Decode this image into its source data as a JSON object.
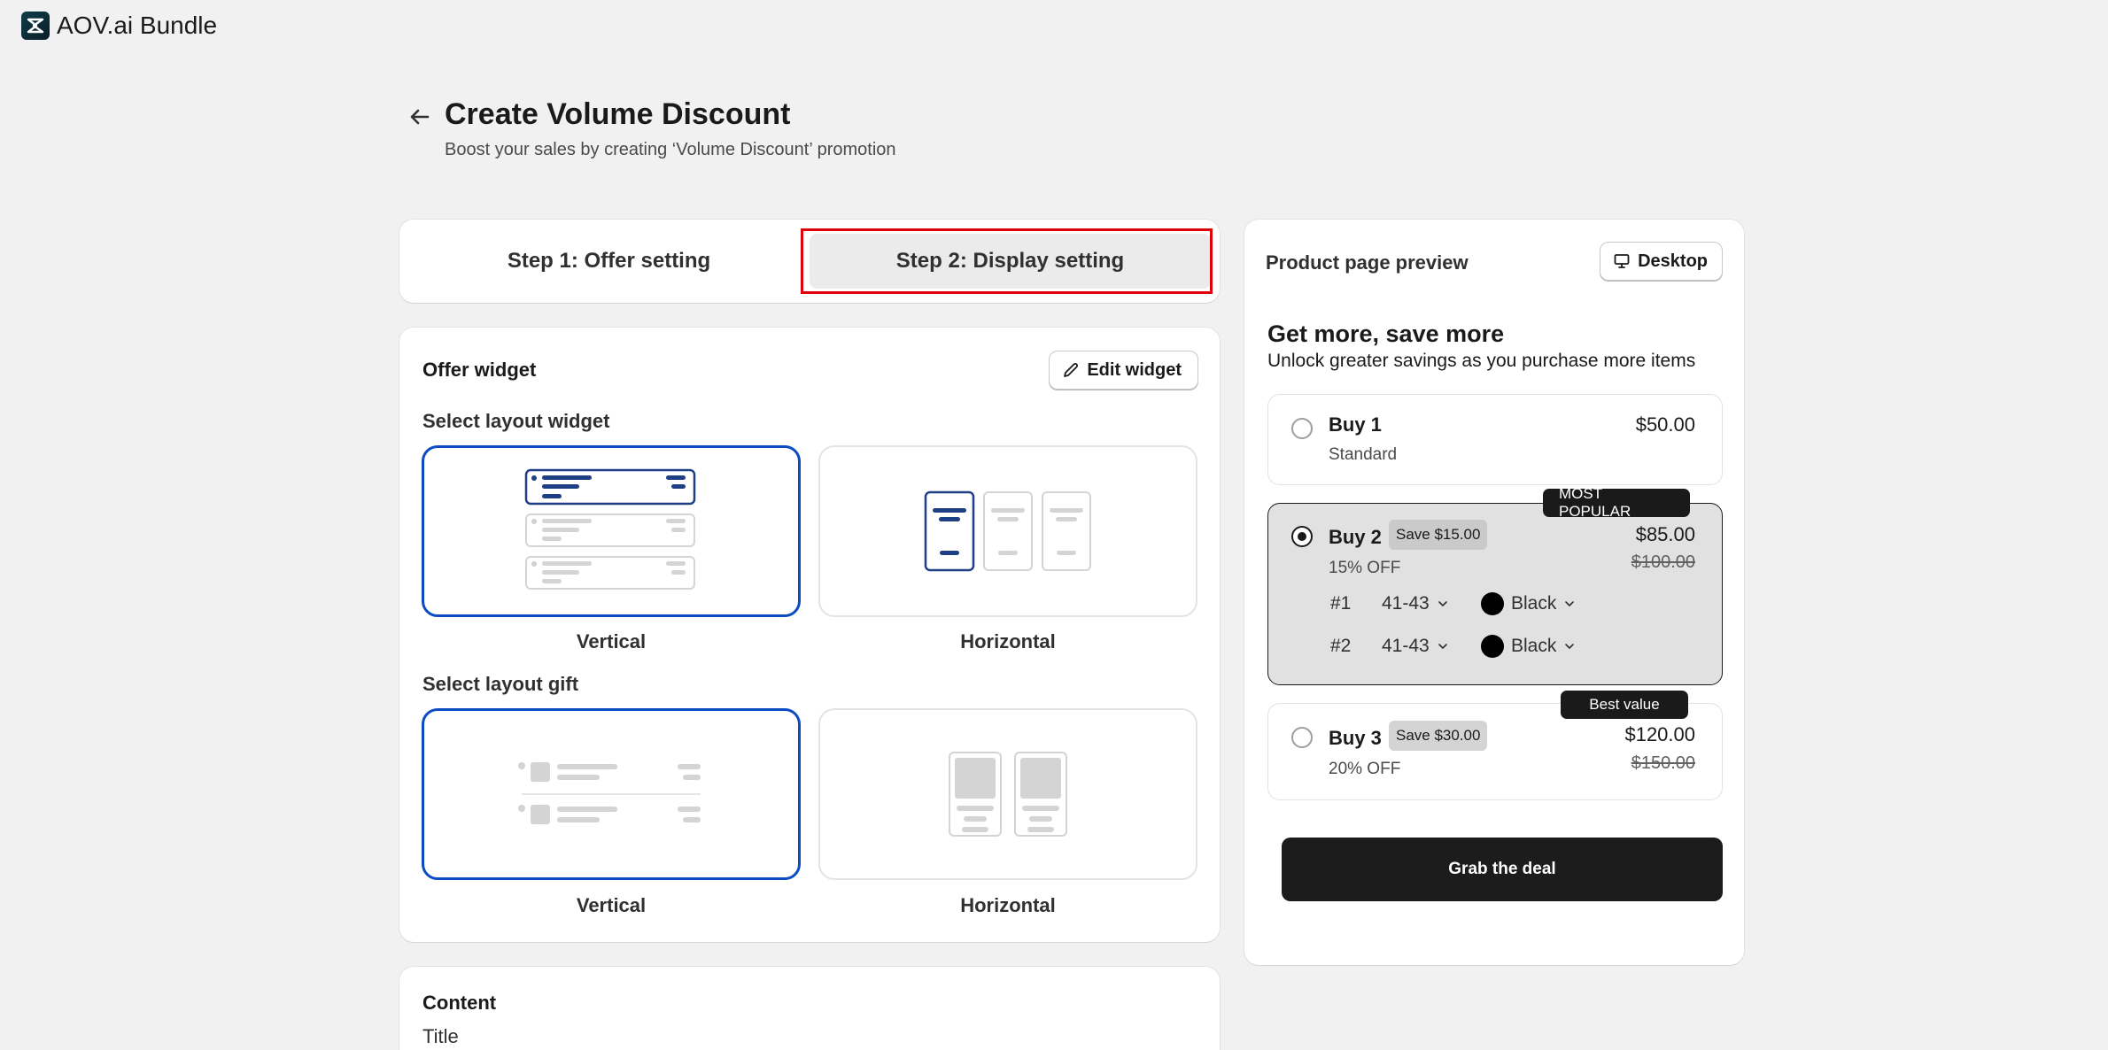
{
  "app": {
    "title": "AOV.ai Bundle"
  },
  "header": {
    "title": "Create Volume Discount",
    "subtitle": "Boost your sales by creating ‘Volume Discount’ promotion"
  },
  "steps": [
    {
      "label": "Step 1: Offer setting",
      "active": false
    },
    {
      "label": "Step 2: Display setting",
      "active": true
    }
  ],
  "offer_widget": {
    "title": "Offer widget",
    "edit_label": "Edit widget",
    "layout_widget_label": "Select layout widget",
    "layout_widget_options": [
      {
        "label": "Vertical",
        "selected": true
      },
      {
        "label": "Horizontal",
        "selected": false
      }
    ],
    "layout_gift_label": "Select layout gift",
    "layout_gift_options": [
      {
        "label": "Vertical",
        "selected": true
      },
      {
        "label": "Horizontal",
        "selected": false
      }
    ]
  },
  "content": {
    "title": "Content",
    "field_title": "Title"
  },
  "preview": {
    "title": "Product page preview",
    "device_label": "Desktop",
    "heading": "Get more, save more",
    "subheading": "Unlock greater savings as you purchase more items",
    "tiers": [
      {
        "name": "Buy 1",
        "sub": "Standard",
        "price": "$50.00",
        "selected": false
      },
      {
        "name": "Buy 2",
        "save": "Save $15.00",
        "sub": "15% OFF",
        "price": "$85.00",
        "old_price": "$100.00",
        "ribbon": "MOST POPULAR",
        "selected": true,
        "variants": [
          {
            "num": "#1",
            "size": "41-43",
            "color": "Black"
          },
          {
            "num": "#2",
            "size": "41-43",
            "color": "Black"
          }
        ]
      },
      {
        "name": "Buy 3",
        "save": "Save $30.00",
        "sub": "20% OFF",
        "price": "$120.00",
        "old_price": "$150.00",
        "ribbon": "Best value",
        "selected": false
      }
    ],
    "cta_label": "Grab the deal"
  },
  "colors": {
    "accent": "#0b4cc5",
    "highlight": "#e0000a",
    "cta": "#1c1c1c"
  }
}
